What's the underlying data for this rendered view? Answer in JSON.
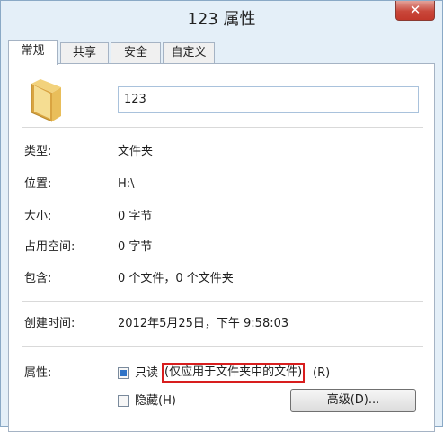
{
  "window": {
    "title": "123 属性",
    "close_glyph": "✕"
  },
  "tabs": [
    {
      "label": "常规",
      "active": true
    },
    {
      "label": "共享",
      "active": false
    },
    {
      "label": "安全",
      "active": false
    },
    {
      "label": "自定义",
      "active": false
    }
  ],
  "general": {
    "icon": "folder-icon",
    "name_value": "123",
    "rows": [
      {
        "label": "类型:",
        "value": "文件夹"
      },
      {
        "label": "位置:",
        "value": "H:\\"
      },
      {
        "label": "大小:",
        "value": "0 字节"
      },
      {
        "label": "占用空间:",
        "value": "0 字节"
      },
      {
        "label": "包含:",
        "value": "0 个文件，0 个文件夹"
      },
      {
        "label": "创建时间:",
        "value": "2012年5月25日，下午 9:58:03"
      }
    ],
    "attributes_label": "属性:",
    "readonly": {
      "label": "只读",
      "note": "(仅应用于文件夹中的文件)",
      "shortcut": "(R)",
      "state": "indeterminate"
    },
    "hidden": {
      "label": "隐藏(H)",
      "checked": false
    },
    "advanced_label": "高级(D)..."
  },
  "colors": {
    "highlight": "#d81e1e",
    "window_bg": "#e4eff8",
    "checkbox_fill": "#2f73c7"
  }
}
